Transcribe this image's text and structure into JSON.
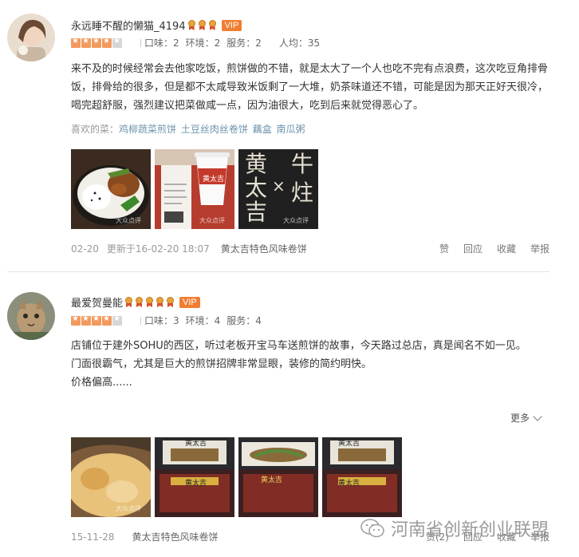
{
  "reviews": [
    {
      "user": {
        "name": "永远睡不醒的懒猫_4194",
        "badge": "VIP",
        "medals": 3
      },
      "stars": {
        "filled": 4,
        "total": 5
      },
      "scores": {
        "taste": "口味：2",
        "env": "环境：2",
        "service": "服务：2",
        "avg": "人均：35"
      },
      "text": "来不及的时候经常会去他家吃饭，煎饼做的不错，就是太大了一个人也吃不完有点浪费，这次吃豆角排骨饭，排骨给的很多，但是都不太咸导致米饭剩了一大堆，奶茶味道还不错，可能是因为那天正好天很冷，喝完超舒服，强烈建议把菜做咸一点，因为油很大，吃到后来就觉得恶心了。",
      "liked_label": "喜欢的菜：",
      "liked_dishes": [
        "鸡柳蔬菜煎饼",
        "土豆丝肉丝卷饼",
        "藕盒",
        "南瓜粥"
      ],
      "photos": [
        "food-bowl",
        "drink-receipt",
        "brand-wall"
      ],
      "date": "02-20",
      "updated": "更新于16-02-20 18:07",
      "shop": "黄太吉特色风味卷饼",
      "actions": {
        "like": "赞",
        "reply": "回应",
        "fav": "收藏",
        "report": "举报"
      },
      "photo_text": {
        "cup_brand": "黄太吉",
        "brand_chars": [
          "黄",
          "太",
          "吉",
          "×",
          "牛",
          "炷"
        ]
      }
    },
    {
      "user": {
        "name": "最爱贺曼能",
        "badge": "VIP",
        "medals": 5
      },
      "stars": {
        "filled": 4,
        "total": 5
      },
      "scores": {
        "taste": "口味：3",
        "env": "环境：4",
        "service": "服务：4"
      },
      "text_lines": [
        "店铺位于建外SOHU的西区，听过老板开宝马车送煎饼的故事，今天路过总店，真是闻名不如一见。",
        "门面很霸气，尤其是巨大的煎饼招牌非常显眼，装修的简约明快。",
        "价格偏高......"
      ],
      "more": "更多",
      "photos": [
        "wrap-closeup",
        "storefront-1",
        "storefront-2",
        "storefront-3"
      ],
      "date": "15-11-28",
      "shop": "黄太吉特色风味卷饼",
      "actions": {
        "like": "赞(2)",
        "reply": "回应",
        "fav": "收藏",
        "report": "举报"
      },
      "photo_text": {
        "store_sign": "黄太吉"
      }
    }
  ],
  "photo_watermark": "大众点评",
  "watermark": "河南省创新创业联盟",
  "colors": {
    "vip": "#f07e32",
    "star": "#f29a5e",
    "dish": "#6d94ad"
  }
}
